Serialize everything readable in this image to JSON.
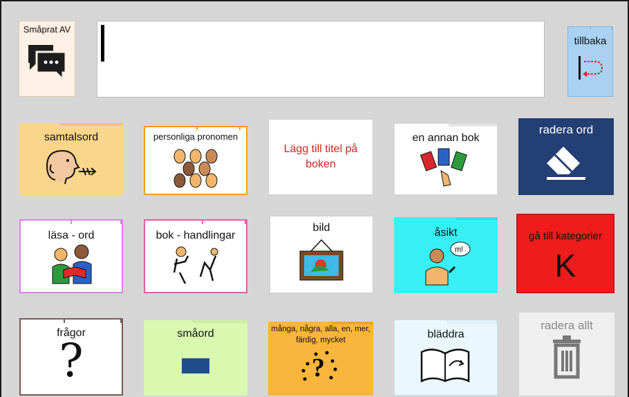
{
  "header": {
    "chat_label": "Småprat AV",
    "message_text": "",
    "back_label": "tillbaka"
  },
  "grid": {
    "r1": [
      "samtalsord",
      "personliga pronomen",
      "Lägg till titel på boken",
      "en annan bok",
      "radera ord"
    ],
    "r2": [
      "läsa - ord",
      "bok - handlingar",
      "bild",
      "åsikt",
      "gå till kategorier"
    ],
    "r3": [
      "frågor",
      "småord",
      "många, några, alla, en, mer, färdig, mycket",
      "bläddra",
      "radera allt"
    ],
    "k_letter": "K",
    "q_mark": "?"
  },
  "icons": [
    "chat-bubbles-icon",
    "return-arrow-icon",
    "speaking-head-icon",
    "faces-icon",
    "books-icon",
    "eraser-icon",
    "reading-people-icon",
    "actions-icon",
    "framed-picture-icon",
    "opinion-person-icon",
    "question-mark-icon",
    "rectangle-icon",
    "dotted-question-icon",
    "page-turn-icon",
    "trash-icon"
  ],
  "colors": {
    "background": "#d6d6d6",
    "radera_ord": "#233f73",
    "ga_till": "#ee1c1c",
    "asikt": "#38f0f4",
    "samtalsord": "#fbd58a",
    "smaord": "#d9f9b0",
    "manga": "#f9b53c"
  }
}
